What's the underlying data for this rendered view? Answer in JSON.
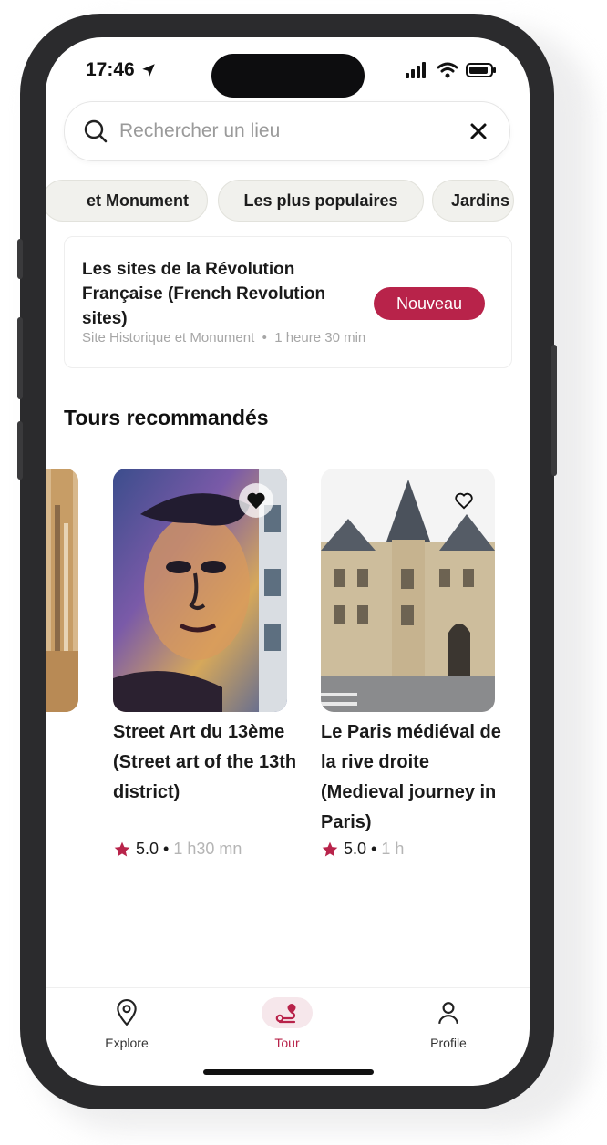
{
  "status_bar": {
    "time": "17:46"
  },
  "search": {
    "placeholder": "Rechercher un lieu"
  },
  "chips": [
    "et Monument",
    "Les plus populaires",
    "Jardins"
  ],
  "featured": {
    "title": "Les sites de la Révolution Française (French Revolution sites)",
    "category": "Site Historique et Monument",
    "duration": "1 heure 30 min",
    "badge": "Nouveau"
  },
  "section_title": "Tours recommandés",
  "tours": [
    {
      "title": "Street Art du 13ème (Street art of the 13th district)",
      "rating": "5.0",
      "duration": "1 h30 mn",
      "favorited": true
    },
    {
      "title": "Le Paris médiéval de la rive droite (Medieval journey in Paris)",
      "rating": "5.0",
      "duration": "1 h",
      "favorited": false
    }
  ],
  "tabs": [
    {
      "label": "Explore",
      "icon": "location-pin-icon",
      "active": false
    },
    {
      "label": "Tour",
      "icon": "route-icon",
      "active": true
    },
    {
      "label": "Profile",
      "icon": "person-icon",
      "active": false
    }
  ],
  "colors": {
    "accent": "#b8234a",
    "chip_bg": "#f1f1ed",
    "text": "#1a1a1a",
    "muted": "#a6a6a6"
  }
}
